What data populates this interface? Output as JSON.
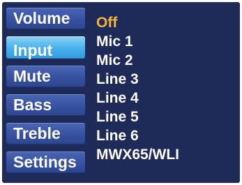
{
  "menu": {
    "items": [
      {
        "label": "Volume"
      },
      {
        "label": "Input"
      },
      {
        "label": "Mute"
      },
      {
        "label": "Bass"
      },
      {
        "label": "Treble"
      },
      {
        "label": "Settings"
      }
    ],
    "active_index": 1
  },
  "options": {
    "items": [
      {
        "label": "Off"
      },
      {
        "label": "Mic 1"
      },
      {
        "label": "Mic 2"
      },
      {
        "label": "Line 3"
      },
      {
        "label": "Line 4"
      },
      {
        "label": "Line 5"
      },
      {
        "label": "Line 6"
      },
      {
        "label": "MWX65/WLI"
      }
    ],
    "selected_index": 0,
    "selected_color": "#f4b53a"
  },
  "colors": {
    "screen_bg": "#1e2a58",
    "button": "#3a54a3",
    "button_active": "#4cb2ec",
    "text": "#ffffff"
  }
}
